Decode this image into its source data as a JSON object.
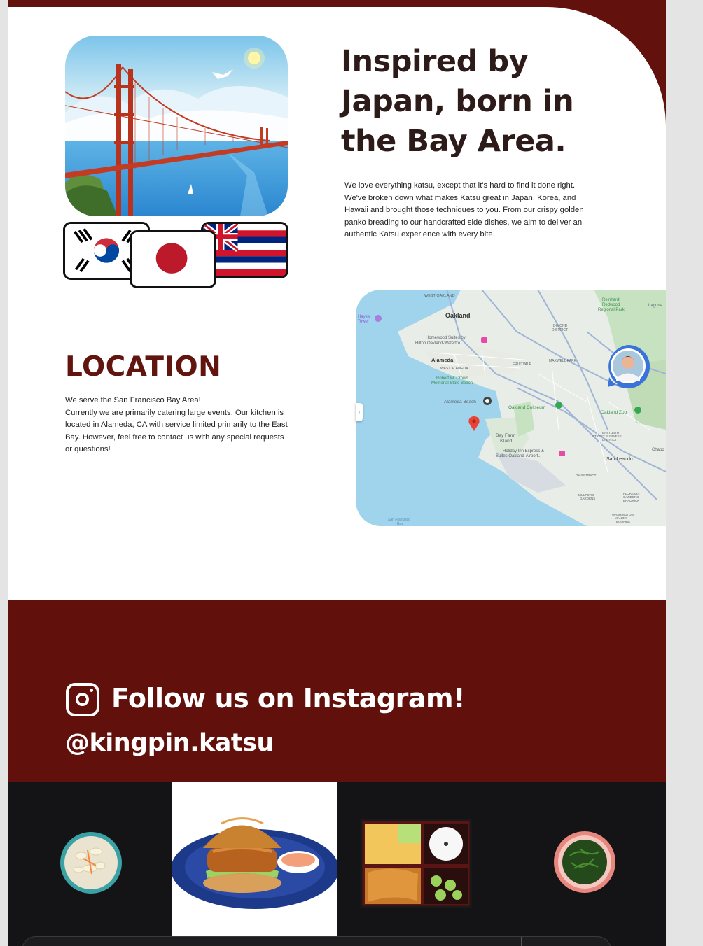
{
  "intro": {
    "title": "Inspired by Japan, born in the Bay Area.",
    "body": "We love everything katsu, except that it's hard to find it done right. We've broken down what makes Katsu great in Japan, Korea, and Hawaii and brought those techniques to you. From our crispy golden panko breading to our handcrafted side dishes, we aim to deliver an authentic Katsu experience with every bite.",
    "hero_image": "golden-gate-bridge-illustration",
    "flags": [
      "south-korea-flag",
      "japan-flag",
      "hawaii-flag"
    ]
  },
  "location": {
    "title": "LOCATION",
    "line1": "We serve the San Francisco Bay Area!",
    "line2": "Currently we are primarily catering large events. Our kitchen is located in Alameda, CA with service limited primarily to the East Bay. However, feel free to contact us with any special requests or questions!"
  },
  "map": {
    "collapse_glyph": "‹",
    "labels": {
      "west_oakland": "WEST OAKLAND",
      "oakland": "Oakland",
      "hayes_tower_1": "Hayes",
      "hayes_tower_2": "Tower",
      "homewood_1": "Homewood Suites by",
      "homewood_2": "Hilton Oakland-Waterfro...",
      "alameda": "Alameda",
      "west_alameda": "WEST ALAMEDA",
      "crown_1": "Robert W. Crown",
      "crown_2": "Memorial State Beach",
      "alameda_beach": "Alameda Beach",
      "fruitvale": "FRUITVALE",
      "dimond_1": "DIMOND",
      "dimond_2": "DISTRICT",
      "maxwell_park": "MAXWELL PARK",
      "reinhardt_1": "Reinhardt",
      "reinhardt_2": "Redwood",
      "reinhardt_3": "Regional Park",
      "laguna": "Laguna",
      "oakland_coliseum": "Oakland Coliseum",
      "oakland_zoo": "Oakland Zoo",
      "bay_farm_1": "Bay Farm",
      "bay_farm_2": "Island",
      "holiday_1": "Holiday Inn Express &",
      "holiday_2": "Suites Oakland-Airport...",
      "east14_1": "EAST 14TH",
      "east14_2": "STREET BUSINESS",
      "east14_3": "DISTRICT",
      "san_leandro": "San Leandro",
      "davis_tract": "DAVIS TRACT",
      "mulford_1": "MULFORD",
      "mulford_2": "GARDENS",
      "floresta_1": "FLORESTA",
      "floresta_2": "GARDENS-",
      "floresta_3": "BRADRICK",
      "washington_1": "WASHINGTON",
      "washington_2": "MANOR -",
      "washington_3": "BONAIRE",
      "sf_bay_1": "San Francisco",
      "sf_bay_2": "Bay",
      "chabot": "Chabo"
    }
  },
  "instagram": {
    "title": "Follow us on Instagram!",
    "handle": "@kingpin.katsu",
    "icon": "instagram-icon",
    "posts": [
      "macaroni-salad-bowl",
      "katsu-sandwich-plate",
      "katsu-bento-box",
      "seaweed-salad-bowl"
    ]
  },
  "colors": {
    "brand_maroon": "#62100b",
    "title_dark": "#2c1b18",
    "location_red": "#62140e"
  }
}
